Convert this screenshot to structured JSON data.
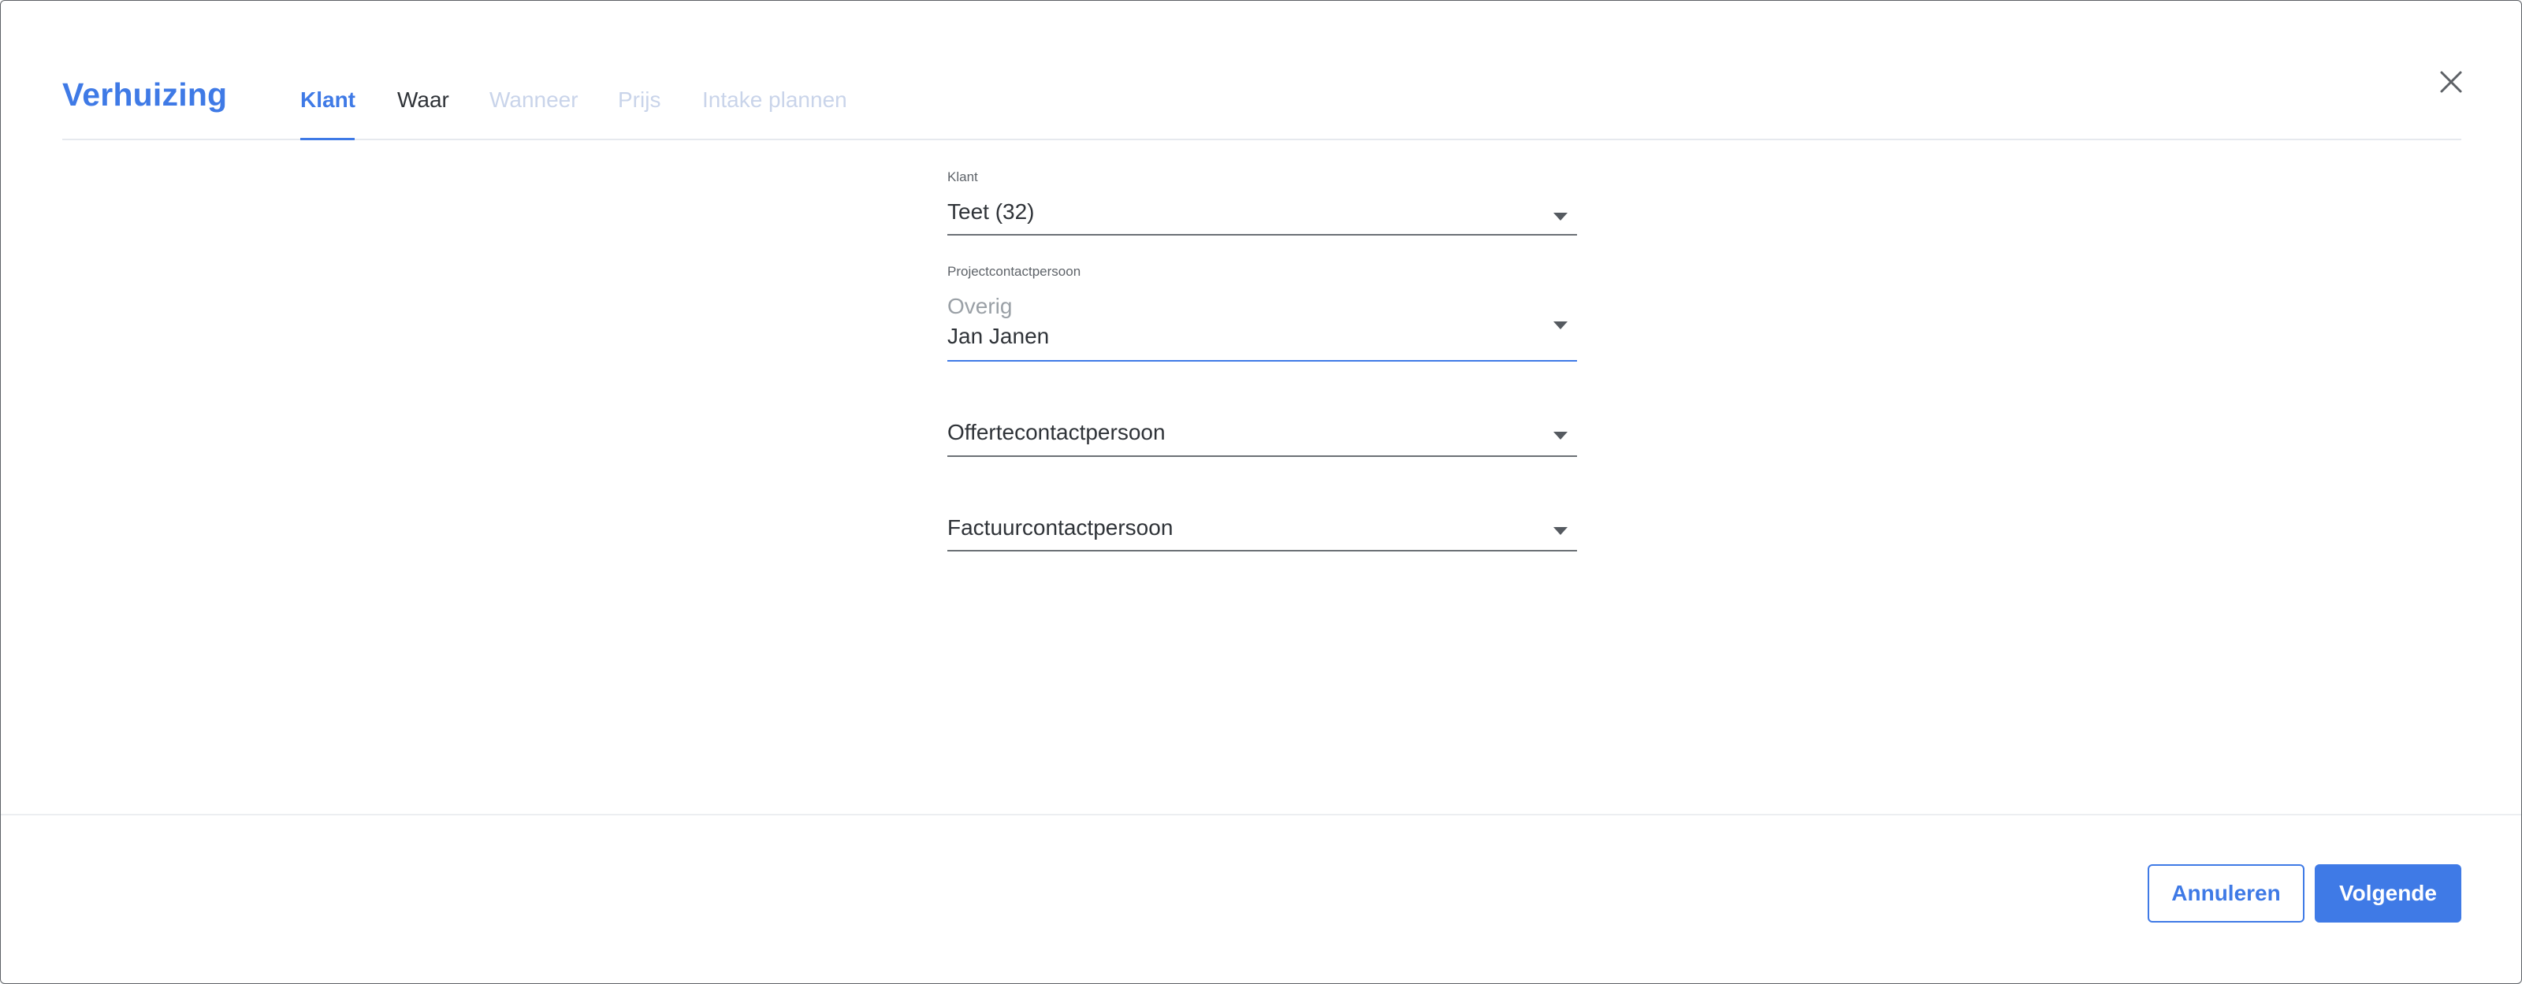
{
  "dialog": {
    "title": "Verhuizing",
    "close_icon": "close-icon"
  },
  "tabs": [
    {
      "label": "Klant",
      "state": "active"
    },
    {
      "label": "Waar",
      "state": "normal"
    },
    {
      "label": "Wanneer",
      "state": "disabled"
    },
    {
      "label": "Prijs",
      "state": "disabled"
    },
    {
      "label": "Intake plannen",
      "state": "disabled"
    }
  ],
  "form": {
    "klant": {
      "label": "Klant",
      "value": "Teet (32)"
    },
    "project_contact": {
      "label": "Projectcontactpersoon",
      "group": "Overig",
      "value": "Jan Janen"
    },
    "offerte_contact": {
      "placeholder": "Offertecontactpersoon"
    },
    "factuur_contact": {
      "placeholder": "Factuurcontactpersoon"
    }
  },
  "footer": {
    "cancel_label": "Annuleren",
    "next_label": "Volgende"
  },
  "colors": {
    "accent": "#3f7ae6",
    "disabled_tab": "#c9d4ea",
    "text": "#2f3338"
  }
}
